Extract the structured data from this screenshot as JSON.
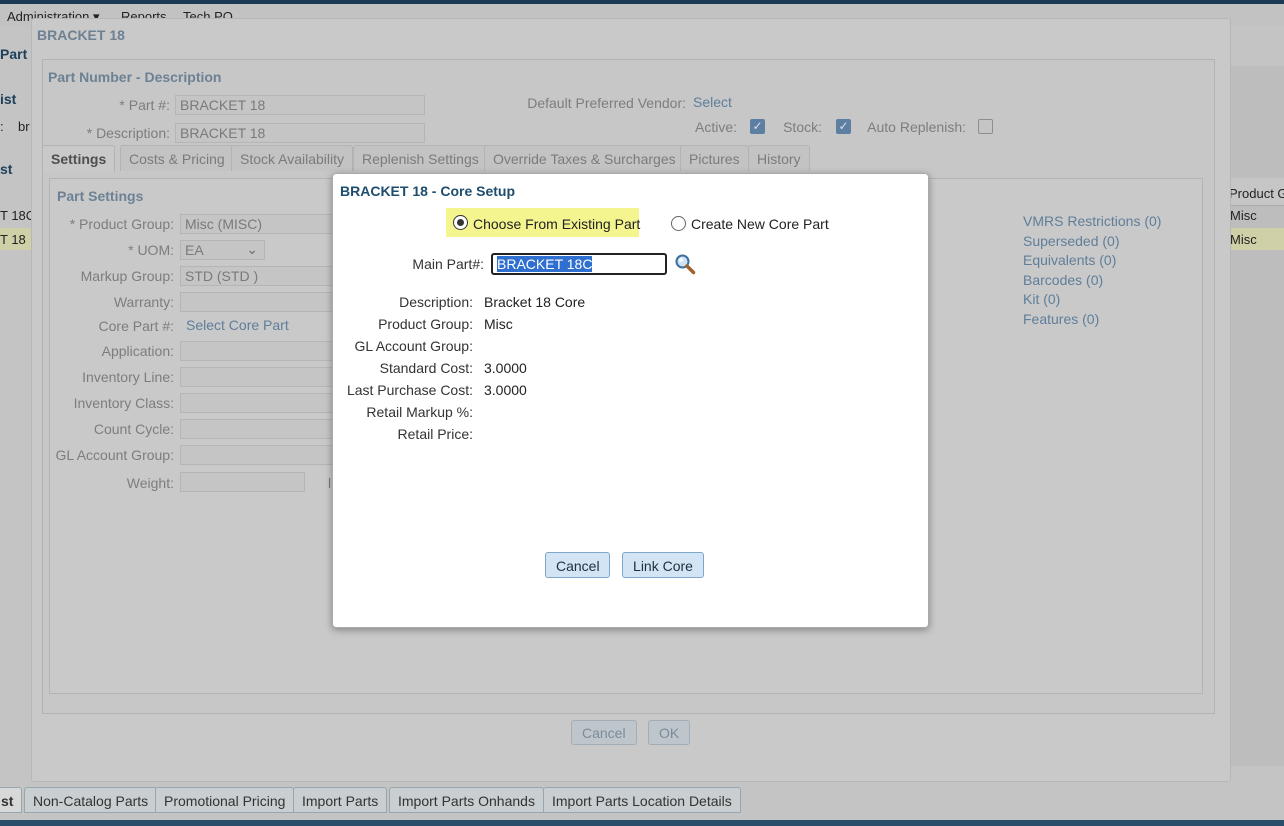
{
  "menu": {
    "administration": "Administration ▾",
    "reports": "Reports",
    "tech_po": "Tech PO"
  },
  "background": {
    "part_fragment": "Part I",
    "list_fragment": "ist",
    "search_label_fragment": ":",
    "search_value_fragment": "br",
    "list2_fragment": "st",
    "rows": [
      {
        "part": "T 18C",
        "group": "Misc"
      },
      {
        "part": "T 18",
        "group": "Misc"
      }
    ],
    "product_col_header": "Product G"
  },
  "bottom_tabs": [
    {
      "label": "st",
      "active": true
    },
    {
      "label": "Non-Catalog Parts"
    },
    {
      "label": "Promotional Pricing"
    },
    {
      "label": "Import Parts"
    },
    {
      "label": "Import Parts Onhands"
    },
    {
      "label": "Import Parts Location Details"
    }
  ],
  "outer_dialog": {
    "title": "BRACKET 18",
    "section_title": "Part Number - Description",
    "part_label": "* Part #:",
    "part_value": "BRACKET 18",
    "description_label": "* Description:",
    "description_value": "BRACKET 18",
    "vendor_label": "Default Preferred Vendor:",
    "vendor_link": "Select",
    "active_label": "Active:",
    "stock_label": "Stock:",
    "auto_replenish_label": "Auto Replenish:",
    "active_checked": true,
    "stock_checked": true,
    "auto_replenish_checked": false,
    "tabs": [
      "Settings",
      "Costs & Pricing",
      "Stock Availability",
      "Replenish Settings",
      "Override Taxes & Surcharges",
      "Pictures",
      "History"
    ],
    "active_tab": "Settings",
    "settings": {
      "title": "Part Settings",
      "product_group_label": "* Product Group:",
      "product_group_value": "Misc (MISC)",
      "uom_label": "* UOM:",
      "uom_value": "EA",
      "markup_label": "Markup Group:",
      "markup_value": "STD (STD )",
      "warranty_label": "Warranty:",
      "core_part_label": "Core Part #:",
      "core_part_link": "Select Core Part",
      "application_label": "Application:",
      "inventory_line_label": "Inventory Line:",
      "inventory_class_label": "Inventory Class:",
      "count_cycle_label": "Count Cycle:",
      "gl_account_label": "GL Account Group:",
      "weight_label": "Weight:",
      "weight_unit_fragment": "l"
    },
    "side_links": [
      "VMRS Restrictions (0)",
      "Superseded (0)",
      "Equivalents (0)",
      "Barcodes (0)",
      "Kit (0)",
      "Features (0)"
    ],
    "cancel_label": "Cancel",
    "ok_label": "OK"
  },
  "modal": {
    "title": "BRACKET 18 - Core Setup",
    "option_existing": "Choose From Existing Part",
    "option_new": "Create New Core Part",
    "selected_option": "existing",
    "main_part_label": "Main Part#:",
    "main_part_value": "BRACKET 18C",
    "details": [
      {
        "label": "Description:",
        "value": "Bracket 18 Core"
      },
      {
        "label": "Product Group:",
        "value": "Misc"
      },
      {
        "label": "GL Account Group:",
        "value": ""
      },
      {
        "label": "Standard Cost:",
        "value": "3.0000"
      },
      {
        "label": "Last Purchase Cost:",
        "value": "3.0000"
      },
      {
        "label": "Retail Markup %:",
        "value": ""
      },
      {
        "label": "Retail Price:",
        "value": ""
      }
    ],
    "cancel_label": "Cancel",
    "link_core_label": "Link Core"
  }
}
